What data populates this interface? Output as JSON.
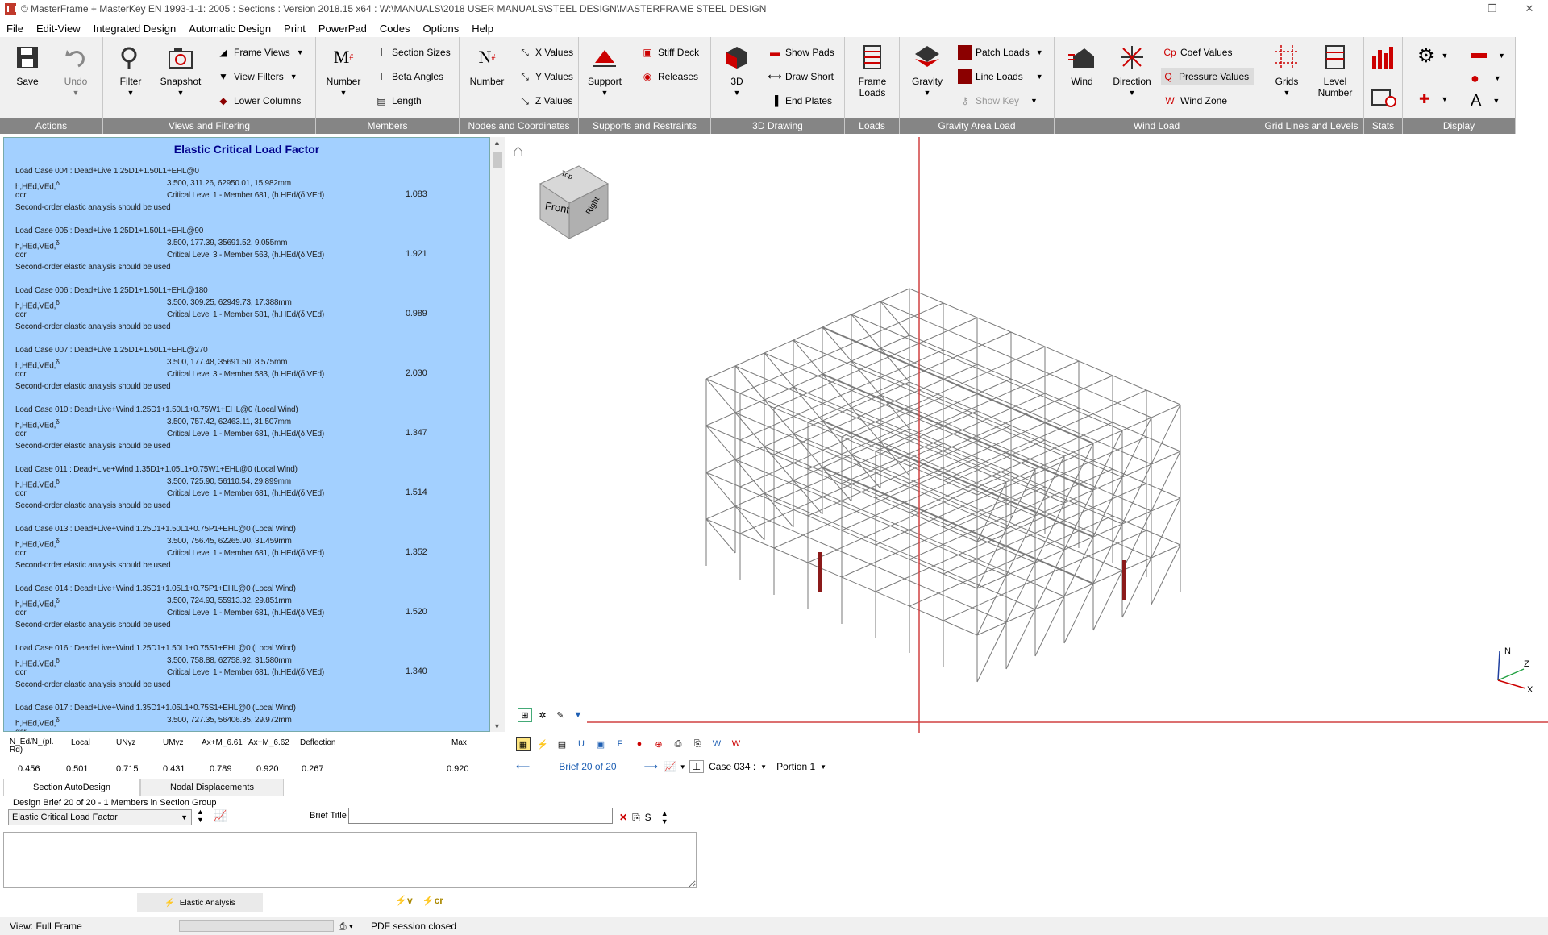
{
  "window": {
    "title": "© MasterFrame + MasterKey EN 1993-1-1: 2005 : Sections : Version 2018.15 x64 : W:\\MANUALS\\2018 USER MANUALS\\STEEL DESIGN\\MASTERFRAME STEEL DESIGN",
    "controls": [
      "—",
      "❐",
      "✕"
    ]
  },
  "menu": [
    "File",
    "Edit-View",
    "Integrated Design",
    "Automatic Design",
    "Print",
    "PowerPad",
    "Codes",
    "Options",
    "Help"
  ],
  "ribbon": {
    "groups": {
      "actions": "Actions",
      "views": "Views and Filtering",
      "members": "Members",
      "nodes": "Nodes and Coordinates",
      "supports": "Supports and Restraints",
      "drawing3d": "3D Drawing",
      "loads": "Loads",
      "gravity": "Gravity Area Load",
      "wind": "Wind Load",
      "grids": "Grid Lines and Levels",
      "stats": "Stats",
      "display": "Display"
    },
    "buttons": {
      "save": "Save",
      "undo": "Undo",
      "filter": "Filter",
      "snapshot": "Snapshot",
      "frame_views": "Frame Views",
      "view_filters": "View Filters",
      "lower_columns": "Lower Columns",
      "member_number": "Number",
      "section_sizes": "Section Sizes",
      "beta_angles": "Beta Angles",
      "length": "Length",
      "node_number": "Number",
      "x_values": "X Values",
      "y_values": "Y Values",
      "z_values": "Z Values",
      "support": "Support",
      "stiff_deck": "Stiff Deck",
      "releases": "Releases",
      "three_d": "3D",
      "show_pads": "Show Pads",
      "draw_short": "Draw Short",
      "end_plates": "End Plates",
      "frame_loads_1": "Frame",
      "frame_loads_2": "Loads",
      "gravity": "Gravity",
      "patch_loads": "Patch Loads",
      "line_loads": "Line Loads",
      "show_key": "Show Key",
      "wind": "Wind",
      "direction": "Direction",
      "coef_values": "Coef Values",
      "pressure_values": "Pressure Values",
      "wind_zone": "Wind Zone",
      "grids": "Grids",
      "level_number_1": "Level",
      "level_number_2": "Number"
    }
  },
  "panel": {
    "title": "Elastic Critical Load Factor",
    "sym_h": "h,HEd,VEd,",
    "sym_delta": "δ",
    "sym_alpha": "αcr",
    "warning": "Second-order elastic analysis should be used",
    "load_cases": [
      {
        "name": "Load Case 004 : Dead+Live 1.25D1+1.50L1+EHL@0",
        "vals": "3.500, 311.26, 62950.01, 15.982mm",
        "crit": "Critical Level 1 - Member 681, (h.HEd/(δ.VEd)",
        "alpha": "1.083"
      },
      {
        "name": "Load Case 005 : Dead+Live 1.25D1+1.50L1+EHL@90",
        "vals": "3.500, 177.39, 35691.52, 9.055mm",
        "crit": "Critical Level 3 - Member 563, (h.HEd/(δ.VEd)",
        "alpha": "1.921"
      },
      {
        "name": "Load Case 006 : Dead+Live 1.25D1+1.50L1+EHL@180",
        "vals": "3.500, 309.25, 62949.73, 17.388mm",
        "crit": "Critical Level 1 - Member 581, (h.HEd/(δ.VEd)",
        "alpha": "0.989"
      },
      {
        "name": "Load Case 007 : Dead+Live 1.25D1+1.50L1+EHL@270",
        "vals": "3.500, 177.48, 35691.50, 8.575mm",
        "crit": "Critical Level 3 - Member 583, (h.HEd/(δ.VEd)",
        "alpha": "2.030"
      },
      {
        "name": "Load Case 010 : Dead+Live+Wind 1.25D1+1.50L1+0.75W1+EHL@0 (Local Wind)",
        "vals": "3.500, 757.42, 62463.11, 31.507mm",
        "crit": "Critical Level 1 - Member 681, (h.HEd/(δ.VEd)",
        "alpha": "1.347"
      },
      {
        "name": "Load Case 011 : Dead+Live+Wind 1.35D1+1.05L1+0.75W1+EHL@0 (Local Wind)",
        "vals": "3.500, 725.90, 56110.54, 29.899mm",
        "crit": "Critical Level 1 - Member 681, (h.HEd/(δ.VEd)",
        "alpha": "1.514"
      },
      {
        "name": "Load Case 013 : Dead+Live+Wind 1.25D1+1.50L1+0.75P1+EHL@0 (Local Wind)",
        "vals": "3.500, 756.45, 62265.90, 31.459mm",
        "crit": "Critical Level 1 - Member 681, (h.HEd/(δ.VEd)",
        "alpha": "1.352"
      },
      {
        "name": "Load Case 014 : Dead+Live+Wind 1.35D1+1.05L1+0.75P1+EHL@0 (Local Wind)",
        "vals": "3.500, 724.93, 55913.32, 29.851mm",
        "crit": "Critical Level 1 - Member 681, (h.HEd/(δ.VEd)",
        "alpha": "1.520"
      },
      {
        "name": "Load Case 016 : Dead+Live+Wind 1.25D1+1.50L1+0.75S1+EHL@0 (Local Wind)",
        "vals": "3.500, 758.88, 62758.92, 31.580mm",
        "crit": "Critical Level 1 - Member 681, (h.HEd/(δ.VEd)",
        "alpha": "1.340"
      },
      {
        "name": "Load Case 017 : Dead+Live+Wind 1.35D1+1.05L1+0.75S1+EHL@0 (Local Wind)",
        "vals": "3.500, 727.35, 56406.35, 29.972mm",
        "crit": "",
        "alpha": ""
      }
    ]
  },
  "summary": {
    "headers": [
      "N_Ed/N_(pl. Rd)",
      "Local",
      "UNyz",
      "UMyz",
      "Ax+M_6.61",
      "Ax+M_6.62",
      "Deflection",
      "Max"
    ],
    "values": [
      "0.456",
      "0.501",
      "0.715",
      "0.431",
      "0.789",
      "0.920",
      "0.267",
      "0.920"
    ]
  },
  "viewport": {
    "cube": {
      "top": "Top",
      "front": "Front",
      "right": "Right"
    },
    "axes": {
      "n": "N",
      "z": "Z",
      "x": "X"
    },
    "brief_nav": "Brief 20 of 20",
    "case": "Case 034 :",
    "portion": "Portion 1"
  },
  "bottom": {
    "tabs": [
      "Section AutoDesign",
      "Nodal Displacements"
    ],
    "design_brief": "Design Brief 20 of 20   - 1 Members in Section Group",
    "brief_type": "Elastic Critical Load Factor",
    "brief_title_label": "Brief Title",
    "brief_title_value": "",
    "s_label": "S",
    "elastic_button": "Elastic Analysis"
  },
  "status": {
    "view": "View: Full Frame",
    "pdf": "PDF session closed"
  },
  "colors": {
    "panel_bg": "#a3d0ff",
    "panel_title": "#00008b",
    "ribbon_label": "#858585",
    "red_accent": "#c00000",
    "link_blue": "#1e5fb3"
  }
}
